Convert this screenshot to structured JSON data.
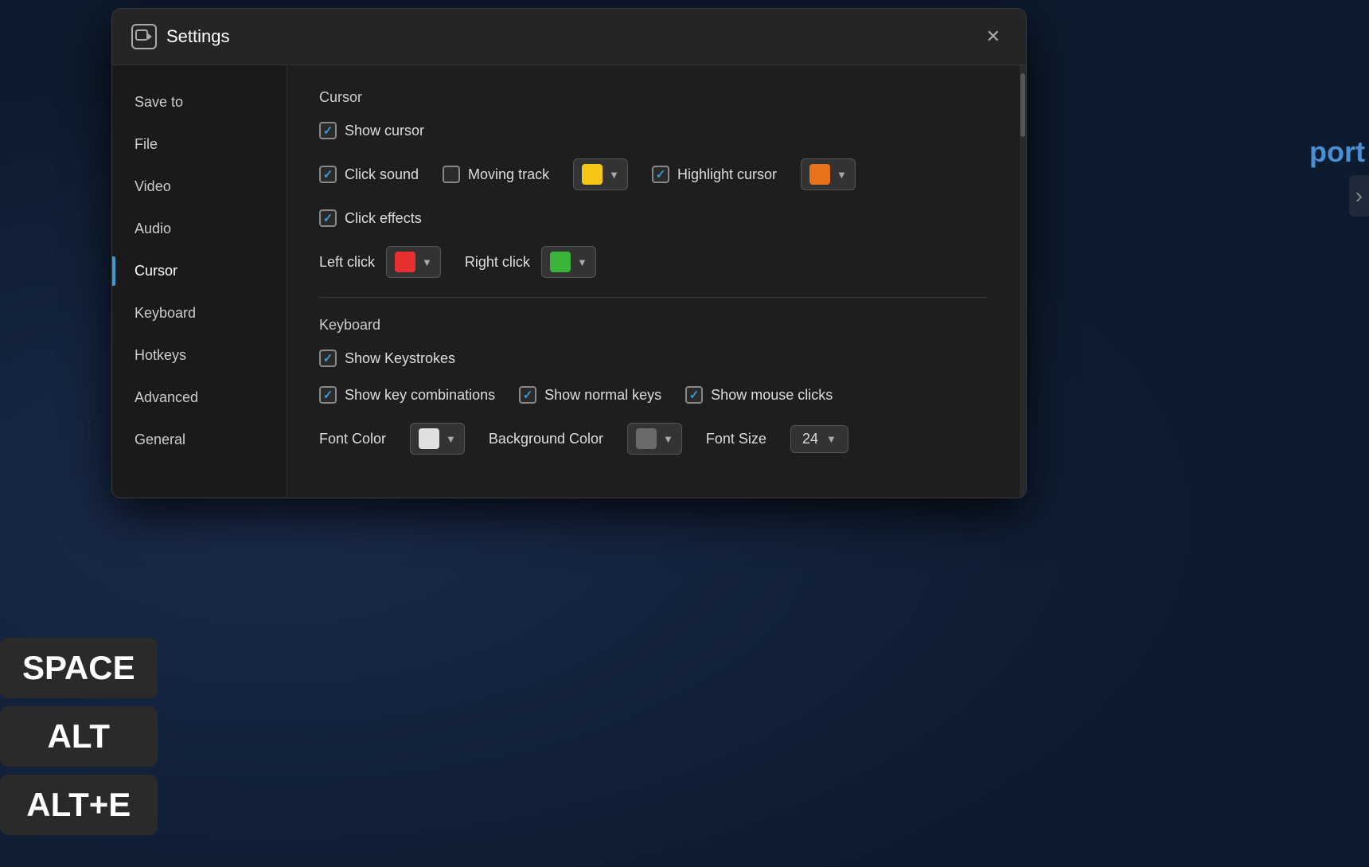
{
  "background": {
    "keys": [
      "SPACE",
      "ALT",
      "ALT+E"
    ]
  },
  "dialog": {
    "title": "Settings",
    "icon_label": "screen-record-icon",
    "close_label": "✕",
    "sidebar": {
      "items": [
        {
          "label": "Save to",
          "active": false
        },
        {
          "label": "File",
          "active": false
        },
        {
          "label": "Video",
          "active": false
        },
        {
          "label": "Audio",
          "active": false
        },
        {
          "label": "Cursor",
          "active": true
        },
        {
          "label": "Keyboard",
          "active": false
        },
        {
          "label": "Hotkeys",
          "active": false
        },
        {
          "label": "Advanced",
          "active": false
        },
        {
          "label": "General",
          "active": false
        }
      ]
    },
    "cursor_section": {
      "title": "Cursor",
      "show_cursor": {
        "label": "Show cursor",
        "checked": true
      },
      "click_sound": {
        "label": "Click sound",
        "checked": true
      },
      "moving_track": {
        "label": "Moving track",
        "checked": false,
        "color": "#f5c518"
      },
      "highlight_cursor": {
        "label": "Highlight cursor",
        "checked": true,
        "color": "#e8721c"
      },
      "click_effects": {
        "label": "Click effects",
        "checked": true
      },
      "left_click": {
        "label": "Left click",
        "color": "#e83030"
      },
      "right_click": {
        "label": "Right click",
        "color": "#3ab53a"
      }
    },
    "keyboard_section": {
      "title": "Keyboard",
      "show_keystrokes": {
        "label": "Show Keystrokes",
        "checked": true
      },
      "show_key_combinations": {
        "label": "Show key combinations",
        "checked": true
      },
      "show_normal_keys": {
        "label": "Show normal keys",
        "checked": true
      },
      "show_mouse_clicks": {
        "label": "Show mouse clicks",
        "checked": true
      },
      "font_color": {
        "label": "Font Color",
        "color": "#e0e0e0"
      },
      "background_color": {
        "label": "Background Color",
        "color": "#6a6a6a"
      },
      "font_size": {
        "label": "Font Size",
        "value": "24"
      }
    }
  }
}
